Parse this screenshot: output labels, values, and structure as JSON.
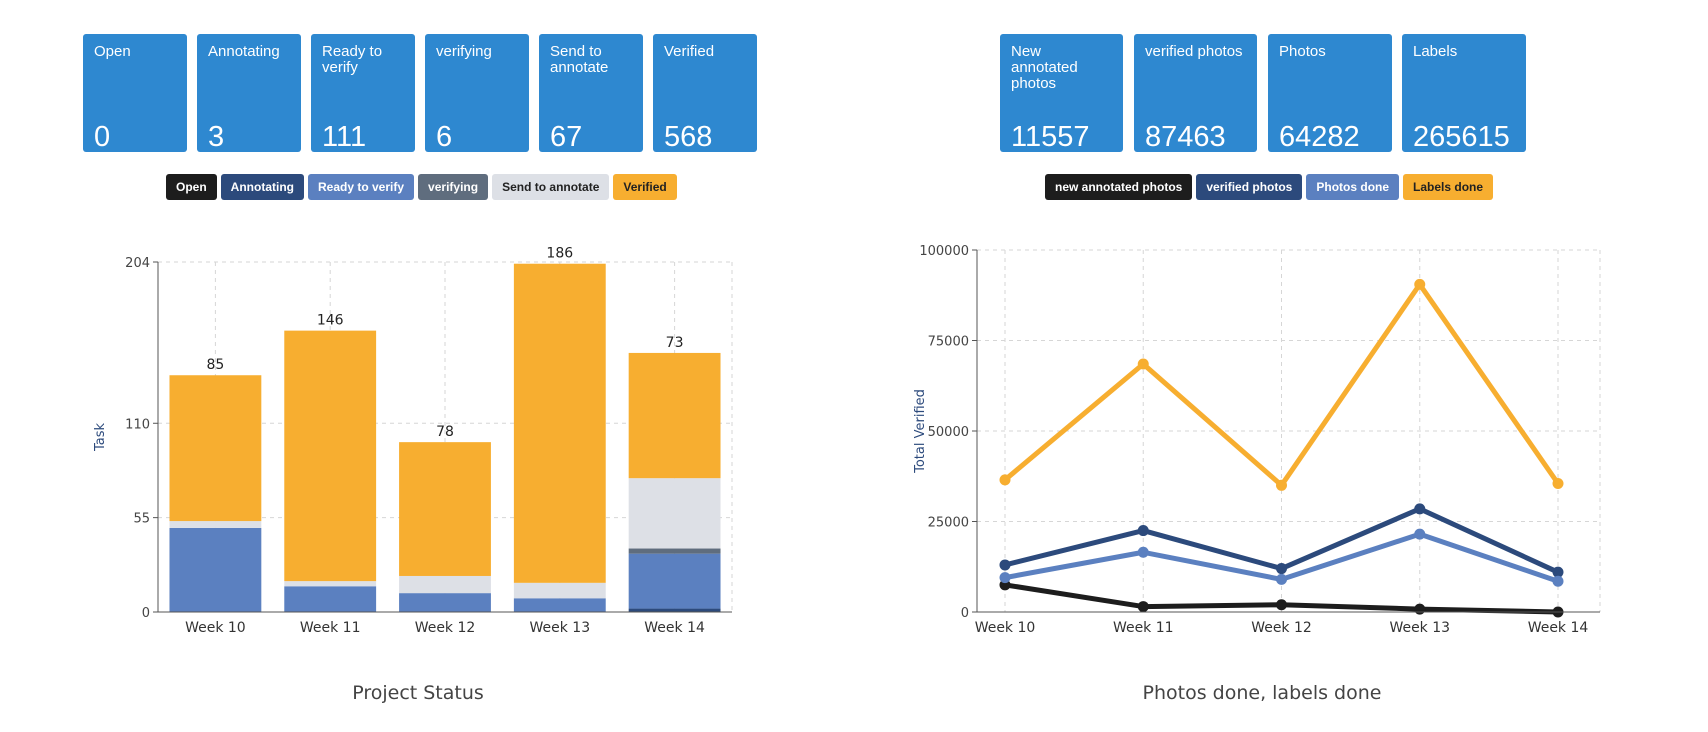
{
  "left_cards": [
    {
      "label": "Open",
      "value": "0"
    },
    {
      "label": "Annotating",
      "value": "3"
    },
    {
      "label": "Ready to verify",
      "value": "111"
    },
    {
      "label": "verifying",
      "value": "6"
    },
    {
      "label": "Send to annotate",
      "value": "67"
    },
    {
      "label": "Verified",
      "value": "568"
    }
  ],
  "right_cards": [
    {
      "label": "New annotated photos",
      "value": "11557"
    },
    {
      "label": "verified photos",
      "value": "87463"
    },
    {
      "label": "Photos",
      "value": "64282"
    },
    {
      "label": "Labels",
      "value": "265615"
    }
  ],
  "left_legend": [
    {
      "label": "Open",
      "color": "#1d1d1d",
      "text_color": "#ffffff"
    },
    {
      "label": "Annotating",
      "color": "#2c4a7c",
      "text_color": "#ffffff"
    },
    {
      "label": "Ready to verify",
      "color": "#5b80c0",
      "text_color": "#ffffff"
    },
    {
      "label": "verifying",
      "color": "#5f6d7e",
      "text_color": "#ffffff"
    },
    {
      "label": "Send to annotate",
      "color": "#dde0e6",
      "text_color": "#222222"
    },
    {
      "label": "Verified",
      "color": "#f7ae30",
      "text_color": "#222222"
    }
  ],
  "right_legend": [
    {
      "label": "new annotated photos",
      "color": "#1d1d1d",
      "text_color": "#ffffff"
    },
    {
      "label": "verified photos",
      "color": "#2c4a7c",
      "text_color": "#ffffff"
    },
    {
      "label": "Photos done",
      "color": "#5b80c0",
      "text_color": "#ffffff"
    },
    {
      "label": "Labels done",
      "color": "#f7ae30",
      "text_color": "#222222"
    }
  ],
  "captions": {
    "left": "Project Status",
    "right": "Photos done, labels done"
  },
  "chart_data": [
    {
      "type": "bar",
      "stacked": true,
      "title": "Project Status",
      "ylabel": "Task",
      "xlabel": "",
      "ylim": [
        0,
        204
      ],
      "yticks": [
        0,
        55,
        110,
        204
      ],
      "grid": true,
      "categories": [
        "Week 10",
        "Week 11",
        "Week 12",
        "Week 13",
        "Week 14"
      ],
      "totals": [
        85,
        146,
        78,
        186,
        73
      ],
      "series": [
        {
          "name": "Open",
          "color": "#1d1d1d",
          "values": [
            0,
            0,
            0,
            0,
            0
          ]
        },
        {
          "name": "Annotating",
          "color": "#2c4a7c",
          "values": [
            0,
            0,
            0,
            0,
            2
          ]
        },
        {
          "name": "Ready to verify",
          "color": "#5b80c0",
          "values": [
            49,
            15,
            11,
            8,
            32
          ]
        },
        {
          "name": "verifying",
          "color": "#5f6d7e",
          "values": [
            0,
            0,
            0,
            0,
            3
          ]
        },
        {
          "name": "Send to annotate",
          "color": "#dde0e6",
          "values": [
            4,
            3,
            10,
            9,
            41
          ]
        },
        {
          "name": "Verified",
          "color": "#f7ae30",
          "values": [
            85,
            146,
            78,
            186,
            73
          ]
        }
      ]
    },
    {
      "type": "line",
      "title": "Photos done, labels done",
      "ylabel": "Total Verified",
      "xlabel": "",
      "ylim": [
        0,
        100000
      ],
      "yticks": [
        0,
        25000,
        50000,
        75000,
        100000
      ],
      "grid": true,
      "x": [
        "Week 10",
        "Week 11",
        "Week 12",
        "Week 13",
        "Week 14"
      ],
      "series": [
        {
          "name": "new annotated photos",
          "color": "#1d1d1d",
          "values": [
            7500,
            1500,
            2000,
            800,
            0
          ]
        },
        {
          "name": "verified photos",
          "color": "#2c4a7c",
          "values": [
            13000,
            22500,
            12000,
            28500,
            11000
          ]
        },
        {
          "name": "Photos done",
          "color": "#5b80c0",
          "values": [
            9500,
            16500,
            9000,
            21500,
            8500
          ]
        },
        {
          "name": "Labels done",
          "color": "#f7ae30",
          "values": [
            36500,
            68500,
            35000,
            90500,
            35500
          ]
        }
      ]
    }
  ]
}
